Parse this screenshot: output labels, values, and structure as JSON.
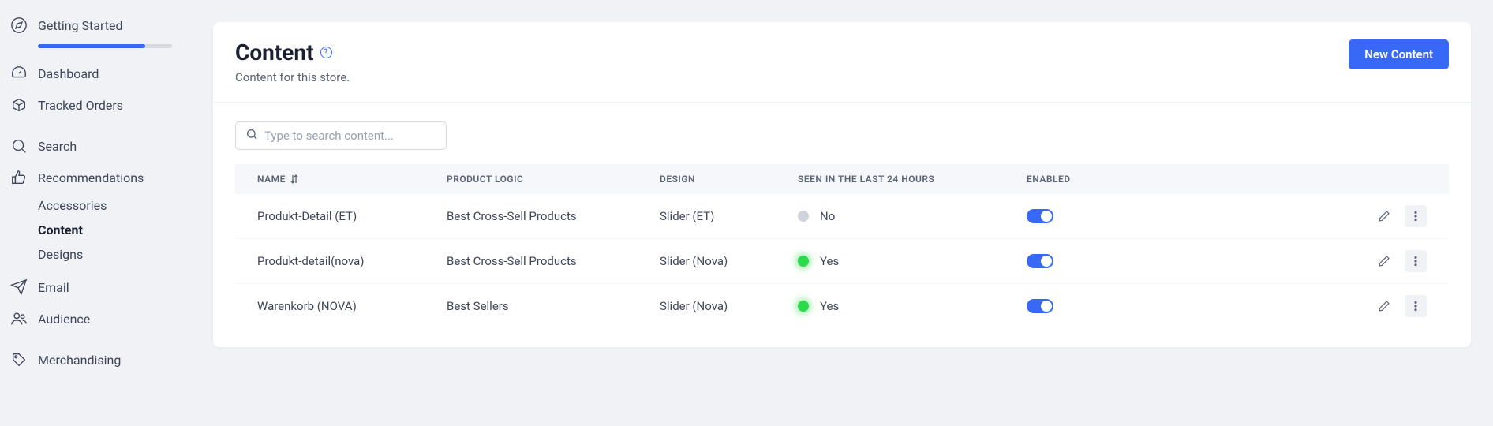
{
  "sidebar": {
    "items": [
      {
        "label": "Getting Started"
      },
      {
        "label": "Dashboard"
      },
      {
        "label": "Tracked Orders"
      },
      {
        "label": "Search"
      },
      {
        "label": "Recommendations"
      },
      {
        "label": "Email"
      },
      {
        "label": "Audience"
      },
      {
        "label": "Merchandising"
      }
    ],
    "subs_recs": [
      {
        "label": "Accessories"
      },
      {
        "label": "Content"
      },
      {
        "label": "Designs"
      }
    ]
  },
  "header": {
    "title": "Content",
    "subtitle": "Content for this store.",
    "button": "New Content"
  },
  "search": {
    "placeholder": "Type to search content..."
  },
  "table": {
    "headers": {
      "name": "NAME",
      "logic": "PRODUCT LOGIC",
      "design": "DESIGN",
      "seen": "SEEN IN THE LAST 24 HOURS",
      "enabled": "ENABLED"
    },
    "rows": [
      {
        "name": "Produkt-Detail (ET)",
        "logic": "Best Cross-Sell Products",
        "design": "Slider (ET)",
        "seen": "No",
        "seen_color": "gray",
        "enabled": true
      },
      {
        "name": "Produkt-detail(nova)",
        "logic": "Best Cross-Sell Products",
        "design": "Slider (Nova)",
        "seen": "Yes",
        "seen_color": "green",
        "enabled": true
      },
      {
        "name": "Warenkorb (NOVA)",
        "logic": "Best Sellers",
        "design": "Slider (Nova)",
        "seen": "Yes",
        "seen_color": "green",
        "enabled": true
      }
    ]
  }
}
